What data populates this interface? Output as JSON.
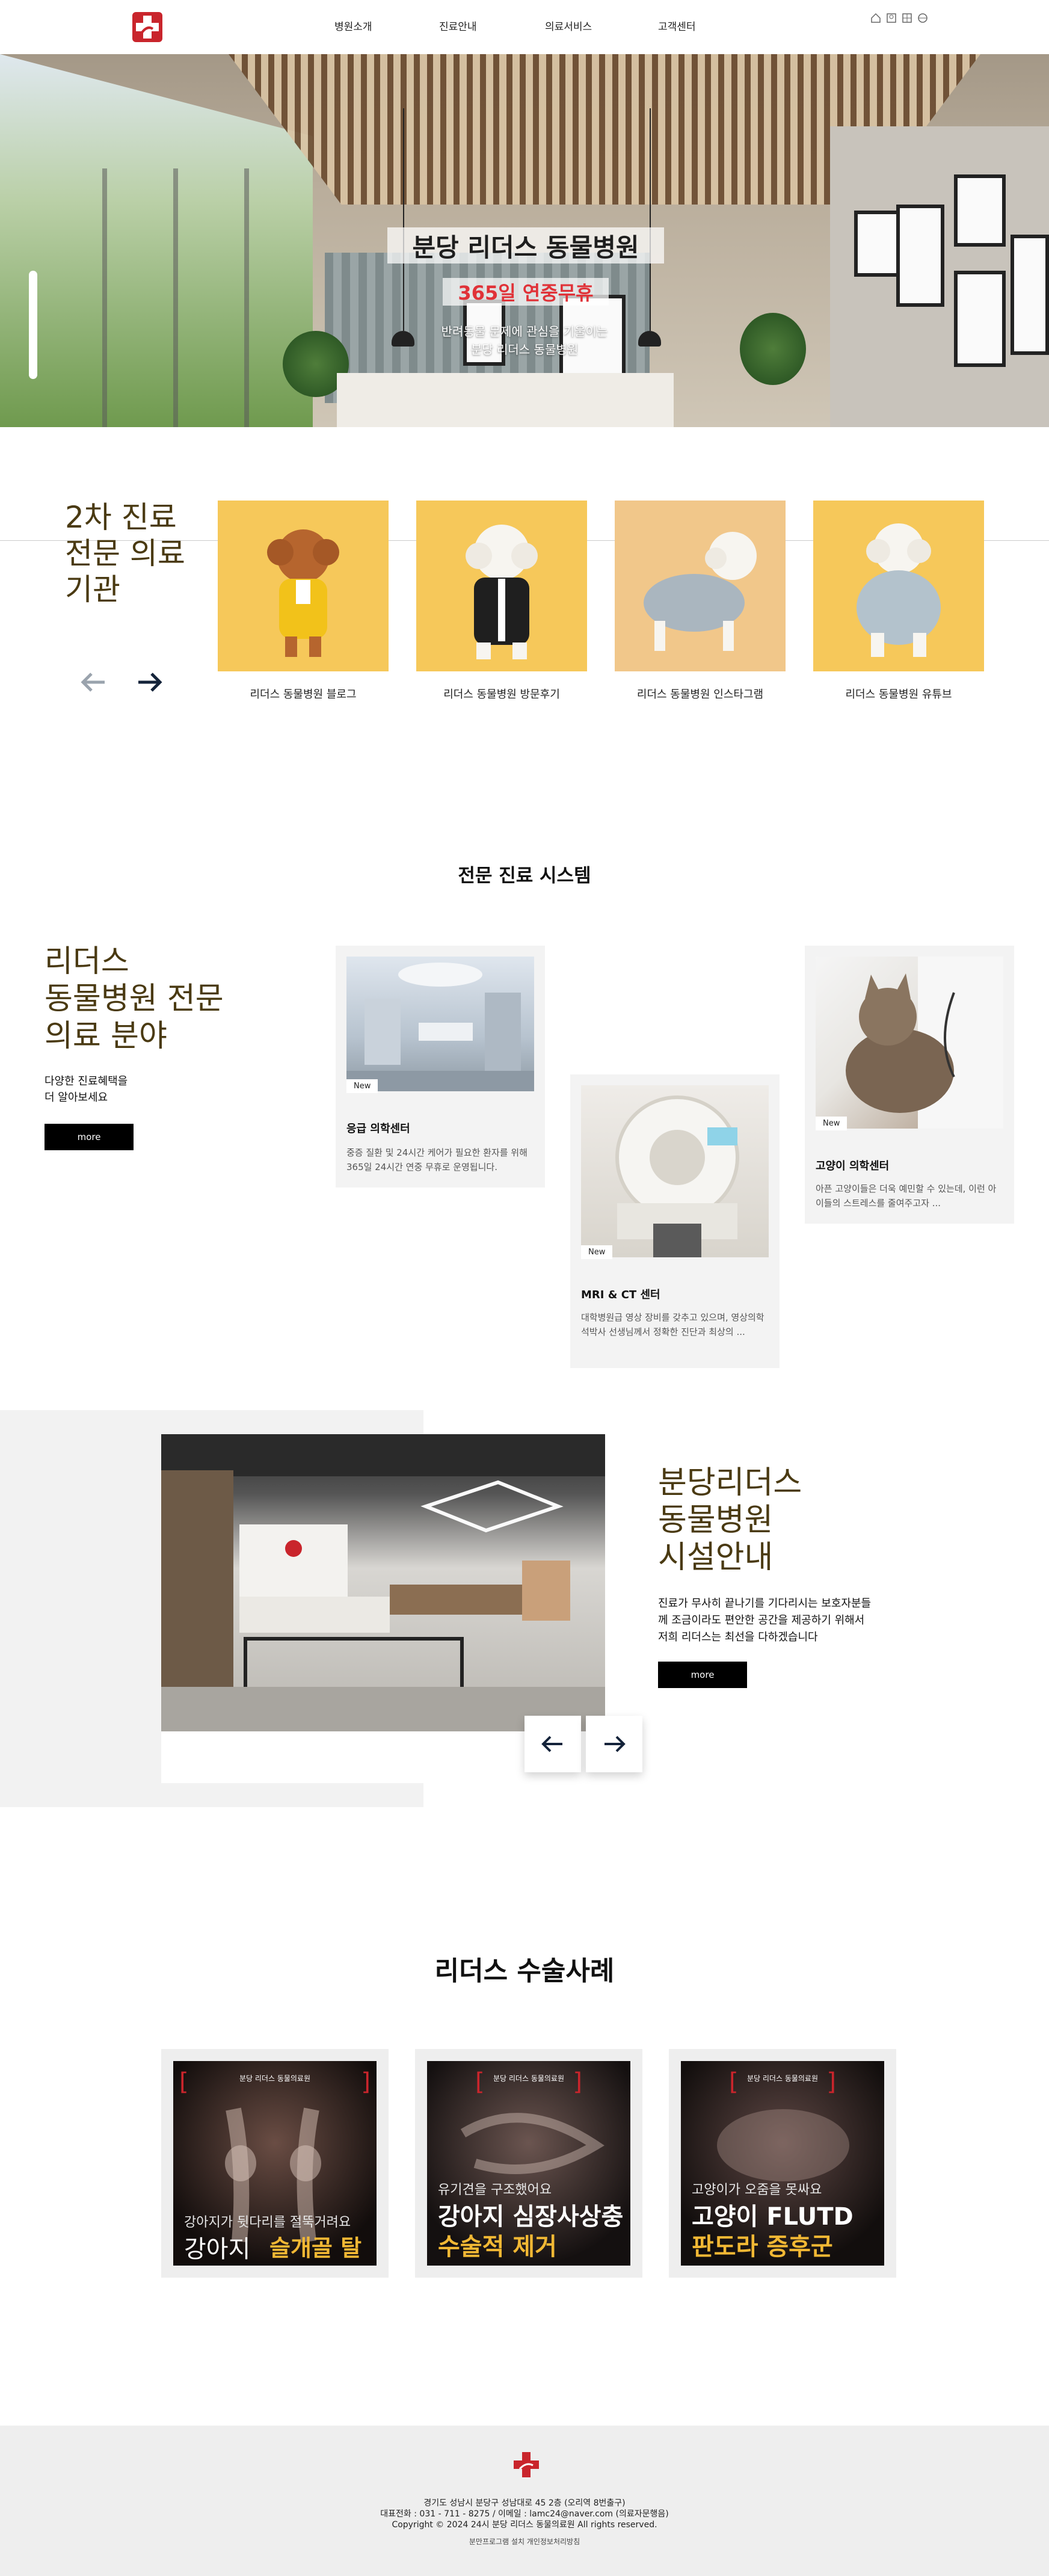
{
  "header": {
    "nav": [
      "병원소개",
      "진료안내",
      "의료서비스",
      "고객센터"
    ],
    "icons": [
      "home-icon",
      "user-icon",
      "grid-icon",
      "globe-icon"
    ],
    "accent": "#c9252c"
  },
  "hero": {
    "title": "분당 리더스 동물병원",
    "badge": "365일 연중무휴",
    "desc_line1": "반려동물 문제에 관심을 기울이는",
    "desc_line2": "분당 리더스 동물병원",
    "badge_color": "#e03238"
  },
  "secondary": {
    "title_line1": "2차 진료",
    "title_line2": "전문 의료",
    "title_line3": "기관",
    "items": [
      {
        "caption": "리더스 동물병원 블로그"
      },
      {
        "caption": "리더스 동물병원 방문후기"
      },
      {
        "caption": "리더스 동물병원 인스타그램"
      },
      {
        "caption": "리더스 동물병원 유튜브"
      }
    ]
  },
  "system": {
    "heading": "전문 진료 시스템",
    "title_line1": "리더스",
    "title_line2": "동물병원 전문",
    "title_line3": "의료 분야",
    "sub_line1": "다양한 진료혜택을",
    "sub_line2": "더 알아보세요",
    "more": "more",
    "cards": [
      {
        "badge": "New",
        "title": "응급 의학센터",
        "text": "중증 질환 및 24시간 케어가 필요한 환자를 위해 365일 24시간 연중 무휴로 운영됩니다."
      },
      {
        "badge": "New",
        "title": "MRI & CT 센터",
        "text": "대학병원급 영상 장비를 갖추고 있으며, 영상의학 석박사 선생님께서 정확한 진단과 최상의 ..."
      },
      {
        "badge": "New",
        "title": "고양이 의학센터",
        "text": "아픈 고양이들은 더욱 예민할 수 있는데, 이런 아이들의 스트레스를 줄여주고자 ..."
      }
    ]
  },
  "facility": {
    "title_line1": "분당리더스",
    "title_line2": "동물병원",
    "title_line3": "시설안내",
    "desc": "진료가 무사히 끝나기를 기다리시는 보호자분들께 조금이라도 편안한 공간을 제공하기 위해서 저희 리더스는 최선을 다하겠습니다",
    "more": "more"
  },
  "surgery": {
    "heading": "리더스 수술사례",
    "brand": "분당 리더스 동물의료원",
    "cases": [
      {
        "line1": "강아지가 뒷다리를 절뚝거려요",
        "line2": "강아지",
        "line3": "슬개골 탈구"
      },
      {
        "line1": "유기견을 구조했어요",
        "line2": "강아지 심장사상충",
        "line3": "수술적 제거"
      },
      {
        "line1": "고양이가 오줌을 못싸요",
        "line2": "고양이 FLUTD",
        "line3": "판도라 증후군"
      }
    ]
  },
  "footer": {
    "address": "경기도 성남시 분당구 성남대로 45 2층 (오리역 8번출구)",
    "contact": "대표전화 : 031 - 711 - 8275 / 이메일 : lamc24@naver.com (의료자문행음)",
    "copyright": "Copyright © 2024 24시 분당 리더스 동물의료원 All rights reserved.",
    "links": "분만프로그램 설치 개인정보처리방침"
  }
}
